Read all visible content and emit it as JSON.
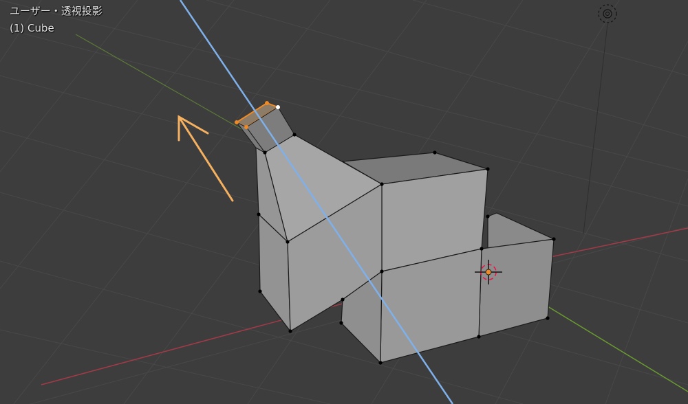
{
  "viewport": {
    "view_name": "ユーザー・透視投影",
    "object_info": "(1) Cube",
    "background_color": "#3d3d3d",
    "grid_color": "#484848",
    "x_axis_color": "#a33a48",
    "y_axis_color": "#6a9a30",
    "knife_line_color": "#7fb0ea",
    "selection_color": "#f08a24",
    "face_color": "#8e8e8e",
    "icons": [
      "light-icon",
      "3d-cursor-icon",
      "move-arrow-icon"
    ]
  }
}
